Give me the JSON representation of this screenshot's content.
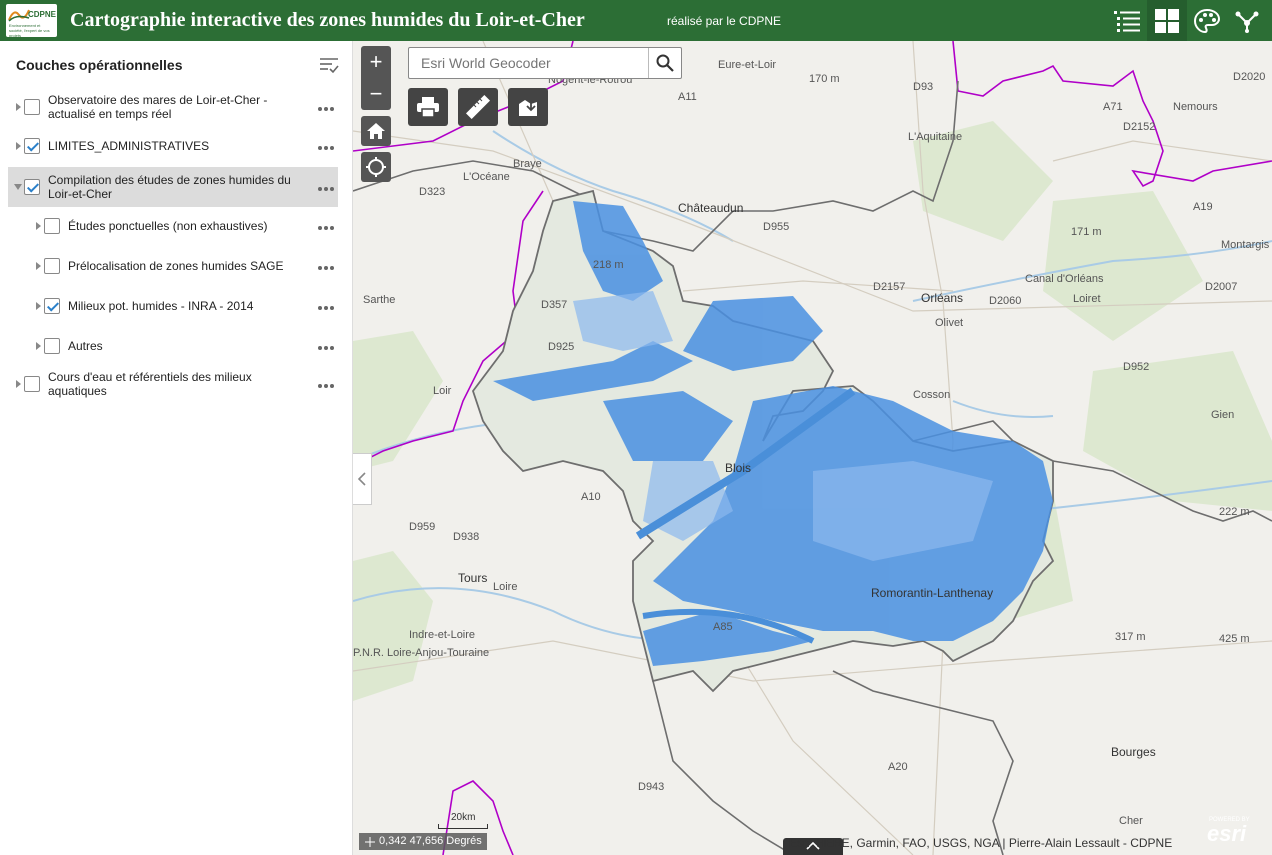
{
  "header": {
    "logo_text": "CDPNE",
    "logo_sub": "Environnement et société, l'expert de vos projets",
    "title": "Cartographie interactive des zones humides du Loir-et-Cher",
    "subtitle": "réalisé par le CDPNE",
    "buttons": [
      "layer-list",
      "basemap-gallery",
      "legend",
      "share"
    ]
  },
  "panel": {
    "title": "Couches opérationnelles",
    "layers": [
      {
        "label": "Observatoire des mares de Loir-et-Cher - actualisé en temps réel",
        "checked": false,
        "expanded": false,
        "level": 0
      },
      {
        "label": "LIMITES_ADMINISTRATIVES",
        "checked": true,
        "expanded": false,
        "level": 0
      },
      {
        "label": "Compilation des études de zones humides du Loir-et-Cher",
        "checked": true,
        "expanded": true,
        "level": 0,
        "selected": true
      },
      {
        "label": "Études ponctuelles (non exhaustives)",
        "checked": false,
        "expanded": false,
        "level": 1
      },
      {
        "label": "Prélocalisation de zones humides SAGE",
        "checked": false,
        "expanded": false,
        "level": 1
      },
      {
        "label": "Milieux pot. humides - INRA - 2014",
        "checked": true,
        "expanded": false,
        "level": 1
      },
      {
        "label": "Autres",
        "checked": false,
        "expanded": false,
        "level": 1
      },
      {
        "label": "Cours d'eau et référentiels des milieux aquatiques",
        "checked": false,
        "expanded": false,
        "level": 0
      }
    ]
  },
  "map": {
    "search_placeholder": "Esri World Geocoder",
    "zoom_in": "+",
    "zoom_out": "−",
    "coords": "0,342 47,656 Degrés",
    "scale": "20km",
    "attribution": "Esri, HERE, Garmin, FAO, USGS, NGA | Pierre-Alain Lessault - CDPNE",
    "esri_powered": "POWERED BY",
    "esri_logo": "esri",
    "place_labels": [
      "Eure-et-Loir",
      "Nogent-le-Rotrou",
      "Nemours",
      "Châteaudun",
      "Sarthe",
      "Orléans",
      "Olivet",
      "Loiret",
      "Montargis",
      "Gien",
      "Blois",
      "Romorantin-Lanthenay",
      "Tours",
      "Indre-et-Loire",
      "P.N.R. Loire-Anjou-Touraine",
      "Bourges",
      "Cher",
      "Canal d'Orléans",
      "Loir",
      "Loire",
      "Cosson",
      "Braye",
      "L'Océane",
      "L'Aquitaine",
      "170 m",
      "171 m",
      "218 m",
      "222 m",
      "317 m",
      "425 m",
      "A11",
      "A10",
      "A19",
      "D955",
      "D2157",
      "D2060",
      "D952",
      "D2152",
      "D2007",
      "D938",
      "D959",
      "D357",
      "D323",
      "A20",
      "A85",
      "A71",
      "D2020",
      "D943",
      "D93",
      "D925"
    ]
  },
  "colors": {
    "header": "#2c6e35",
    "wetland": "#4a90e2",
    "boundary": "#555555",
    "region": "#b000c8"
  }
}
